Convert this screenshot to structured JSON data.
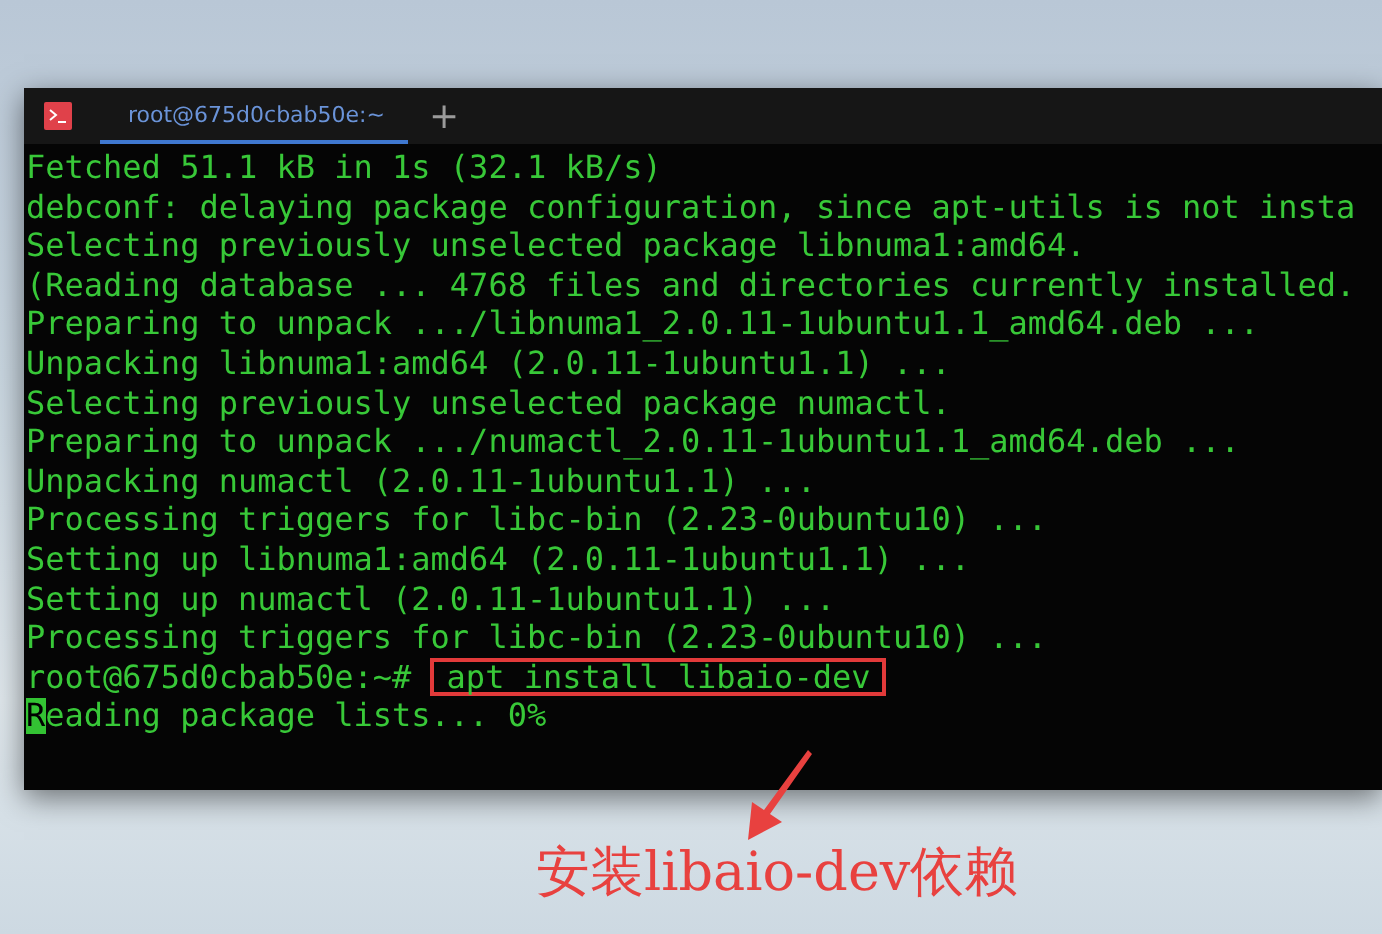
{
  "terminal": {
    "tab": {
      "title": "root@675d0cbab50e:~",
      "selected": true
    },
    "new_tab": "+",
    "lines": [
      {
        "kind": "output",
        "text": "Fetched 51.1 kB in 1s (32.1 kB/s)"
      },
      {
        "kind": "output",
        "text": "debconf: delaying package configuration, since apt-utils is not insta"
      },
      {
        "kind": "output",
        "text": "Selecting previously unselected package libnuma1:amd64."
      },
      {
        "kind": "output",
        "text": "(Reading database ... 4768 files and directories currently installed."
      },
      {
        "kind": "output",
        "text": "Preparing to unpack .../libnuma1_2.0.11-1ubuntu1.1_amd64.deb ..."
      },
      {
        "kind": "output",
        "text": "Unpacking libnuma1:amd64 (2.0.11-1ubuntu1.1) ..."
      },
      {
        "kind": "output",
        "text": "Selecting previously unselected package numactl."
      },
      {
        "kind": "output",
        "text": "Preparing to unpack .../numactl_2.0.11-1ubuntu1.1_amd64.deb ..."
      },
      {
        "kind": "output",
        "text": "Unpacking numactl (2.0.11-1ubuntu1.1) ..."
      },
      {
        "kind": "output",
        "text": "Processing triggers for libc-bin (2.23-0ubuntu10) ..."
      },
      {
        "kind": "output",
        "text": "Setting up libnuma1:amd64 (2.0.11-1ubuntu1.1) ..."
      },
      {
        "kind": "output",
        "text": "Setting up numactl (2.0.11-1ubuntu1.1) ..."
      },
      {
        "kind": "output",
        "text": "Processing triggers for libc-bin (2.23-0ubuntu10) ..."
      },
      {
        "kind": "prompt",
        "prompt": "root@675d0cbab50e:~#",
        "command": "apt install libaio-dev",
        "highlighted": true
      },
      {
        "kind": "output",
        "text": "Reading package lists... 0%",
        "cursor": true
      }
    ]
  },
  "annotation": {
    "caption": "安装libaio-dev依赖"
  }
}
